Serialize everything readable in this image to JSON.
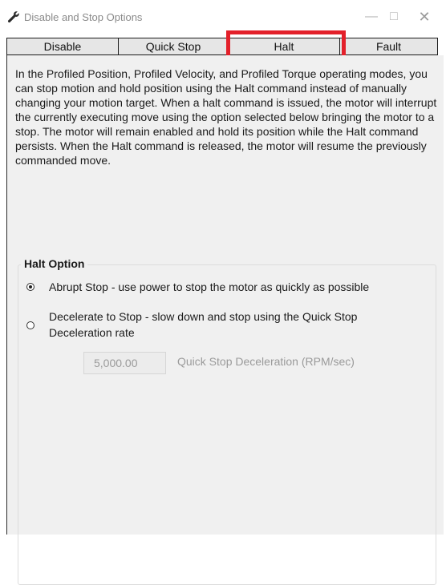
{
  "window": {
    "title": "Disable and Stop Options",
    "icon": "wrench-icon",
    "controls": {
      "minimize": "—",
      "maximize": "□",
      "close": "✕"
    }
  },
  "tabs": [
    {
      "label": "Disable",
      "selected": false
    },
    {
      "label": "Quick Stop",
      "selected": false
    },
    {
      "label": "Halt",
      "selected": true
    },
    {
      "label": "Fault",
      "selected": false
    }
  ],
  "highlight_color": "#e3202a",
  "description": "In the Profiled Position, Profiled Velocity, and Profiled Torque operating modes, you can stop motion and hold position using the Halt command instead of manually changing your motion target. When a halt command is issued, the motor will interrupt the currently executing move using the option selected below bringing the motor to a stop. The motor will remain enabled and hold its position while the Halt command persists. When the Halt command is released, the motor will resume the previously commanded move.",
  "halt_option": {
    "title": "Halt Option",
    "options": [
      {
        "label": "Abrupt Stop - use power to stop the motor as quickly as possible",
        "selected": true
      },
      {
        "label": "Decelerate to Stop - slow down and stop using the Quick Stop Deceleration rate",
        "selected": false
      }
    ],
    "deceleration": {
      "value": "5,000.00",
      "label": "Quick Stop Deceleration (RPM/sec)",
      "enabled": false
    }
  }
}
